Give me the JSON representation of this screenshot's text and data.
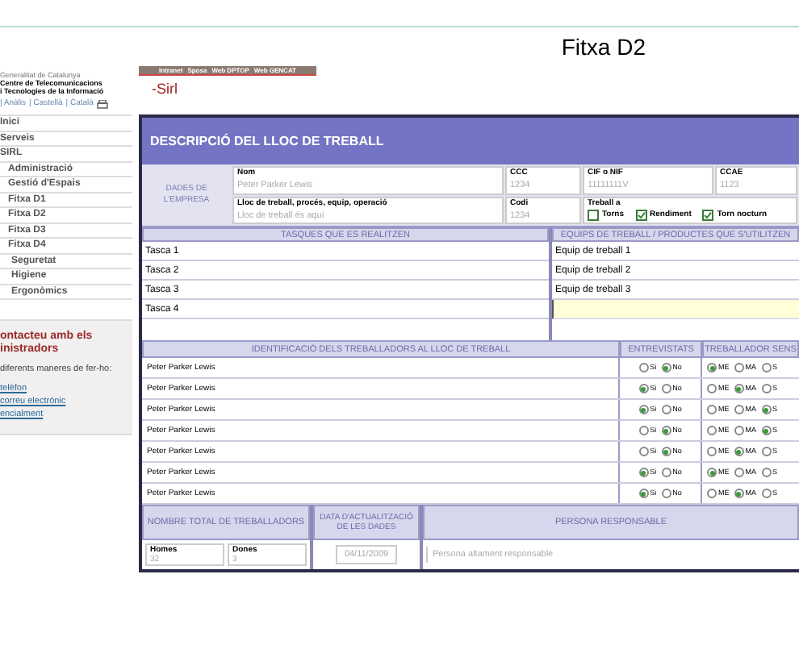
{
  "page_title": "Fitxa D2",
  "sidebar": {
    "logo_lines": [
      "Generalitat de Catalunya",
      "Centre de Telecomunicacions",
      "i Tecnologies de la Informació"
    ],
    "language_links": [
      "| Anàlis",
      "| Castellà",
      "| Català"
    ],
    "menu": [
      {
        "label": "Inici"
      },
      {
        "label": "Serveis"
      },
      {
        "label": "SIRL",
        "children": [
          {
            "label": "Administració"
          },
          {
            "label": "Gestió d'Espais"
          },
          {
            "label": "Fitxa D1"
          },
          {
            "label": "Fitxa D2"
          },
          {
            "label": "Fitxa D3"
          },
          {
            "label": "Fitxa D4",
            "children": [
              {
                "label": "Seguretat"
              },
              {
                "label": "Higiene"
              },
              {
                "label": "Ergonòmics"
              }
            ]
          }
        ]
      }
    ],
    "contact": {
      "title_lines": [
        "ontacteu amb els",
        "inistradors"
      ],
      "text": "diferents maneres de fer-ho:",
      "links": [
        "telèfon",
        "correu electrònic",
        "encialment"
      ]
    }
  },
  "top_nav": [
    "Intranet",
    "Sposa",
    "Web DPTOP",
    "Web GENCAT"
  ],
  "site_name": "-Sirl",
  "form": {
    "title": "DESCRIPCIÓ DEL LLOC DE TREBALL",
    "company_label": "DADES DE L'EMPRESA",
    "fields_row1": [
      {
        "label": "Nom",
        "value": "Peter Parker Lewis"
      },
      {
        "label": "CCC",
        "value": "1234"
      },
      {
        "label": "CIF o NIF",
        "value": "11111111V"
      },
      {
        "label": "CCAE",
        "value": "1123"
      }
    ],
    "fields_row2": [
      {
        "label": "Lloc de treball, procés, equip, operació",
        "value": "Lloc de treball és aquí"
      },
      {
        "label": "Codi",
        "value": "1234"
      }
    ],
    "work_type": {
      "label": "Treball a",
      "options": [
        {
          "label": "Torns",
          "checked": false
        },
        {
          "label": "Rendiment",
          "checked": true
        },
        {
          "label": "Torn nocturn",
          "checked": true
        }
      ]
    },
    "tasks_header": "TASQUES QUE ES REALITZEN",
    "tasks": [
      "Tasca 1",
      "Tasca 2",
      "Tasca 3",
      "Tasca 4"
    ],
    "equipment_header": "EQUIPS DE TREBALL / PRODUCTES QUE S'UTILITZEN",
    "equipment": [
      {
        "value": "Equip de treball 1",
        "focused": false
      },
      {
        "value": "Equip de treball 2",
        "focused": false
      },
      {
        "value": "Equip de treball 3",
        "focused": false
      },
      {
        "focused": true
      }
    ],
    "workers_header": "IDENTIFICACIÓ DELS TREBALLADORS AL LLOC DE TREBALL",
    "interviewed_header": "ENTREVISTATS",
    "sensitive_header": "TREBALLADOR SENS",
    "workers": [
      {
        "name": "Peter Parker Lewis",
        "interviewed": [
          {
            "label": "Si",
            "selected": false
          },
          {
            "label": "No",
            "selected": true
          }
        ],
        "sensitive": [
          {
            "label": "ME",
            "selected": true
          },
          {
            "label": "MA",
            "selected": false
          },
          {
            "label": "S",
            "selected": false
          }
        ]
      },
      {
        "name": "Peter Parker Lewis",
        "interviewed": [
          {
            "label": "Si",
            "selected": true
          },
          {
            "label": "No",
            "selected": false
          }
        ],
        "sensitive": [
          {
            "label": "ME",
            "selected": false
          },
          {
            "label": "MA",
            "selected": true
          },
          {
            "label": "S",
            "selected": false
          }
        ]
      },
      {
        "name": "Peter Parker Lewis",
        "interviewed": [
          {
            "label": "Si",
            "selected": true
          },
          {
            "label": "No",
            "selected": false
          }
        ],
        "sensitive": [
          {
            "label": "ME",
            "selected": false
          },
          {
            "label": "MA",
            "selected": false
          },
          {
            "label": "S",
            "selected": true
          }
        ]
      },
      {
        "name": "Peter Parker Lewis",
        "interviewed": [
          {
            "label": "Si",
            "selected": false
          },
          {
            "label": "No",
            "selected": true
          }
        ],
        "sensitive": [
          {
            "label": "ME",
            "selected": false
          },
          {
            "label": "MA",
            "selected": false
          },
          {
            "label": "S",
            "selected": true
          }
        ]
      },
      {
        "name": "Peter Parker Lewis",
        "interviewed": [
          {
            "label": "Si",
            "selected": false
          },
          {
            "label": "No",
            "selected": true
          }
        ],
        "sensitive": [
          {
            "label": "ME",
            "selected": false
          },
          {
            "label": "MA",
            "selected": true
          },
          {
            "label": "S",
            "selected": false
          }
        ]
      },
      {
        "name": "Peter Parker Lewis",
        "interviewed": [
          {
            "label": "Si",
            "selected": true
          },
          {
            "label": "No",
            "selected": false
          }
        ],
        "sensitive": [
          {
            "label": "ME",
            "selected": true
          },
          {
            "label": "MA",
            "selected": false
          },
          {
            "label": "S",
            "selected": false
          }
        ]
      },
      {
        "name": "Peter Parker Lewis",
        "interviewed": [
          {
            "label": "Si",
            "selected": true
          },
          {
            "label": "No",
            "selected": false
          }
        ],
        "sensitive": [
          {
            "label": "ME",
            "selected": false
          },
          {
            "label": "MA",
            "selected": true
          },
          {
            "label": "S",
            "selected": false
          }
        ]
      }
    ],
    "total_header": "NOMBRE TOTAL DE TREBALLADORS",
    "totals": [
      {
        "label": "Homes",
        "value": "32"
      },
      {
        "label": "Dones",
        "value": "3"
      }
    ],
    "date_header": "DATA D'ACTUALITZACIÓ DE LES DADES",
    "date": "04/11/2009",
    "responsible_header": "PERSONA RESPONSABLE",
    "responsible": "Persona altament responsable"
  }
}
